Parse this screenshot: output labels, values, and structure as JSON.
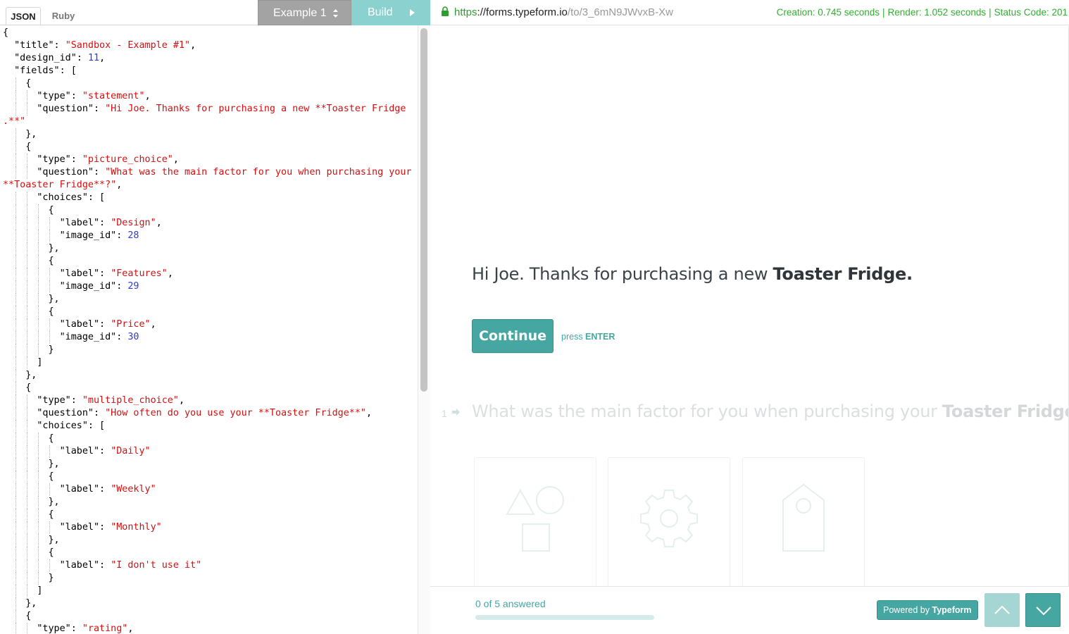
{
  "editor": {
    "tabs": [
      {
        "label": "JSON",
        "active": true
      },
      {
        "label": "Ruby",
        "active": false
      }
    ],
    "example_select": "Example 1",
    "build_label": "Build",
    "code_lines": [
      [
        [
          "p",
          "{"
        ]
      ],
      [
        [
          "p",
          "  \"title\": "
        ],
        [
          "s",
          "\"Sandbox - Example #1\""
        ],
        [
          "p",
          ","
        ]
      ],
      [
        [
          "p",
          "  \"design_id\": "
        ],
        [
          "n",
          "11"
        ],
        [
          "p",
          ","
        ]
      ],
      [
        [
          "p",
          "  \"fields\": ["
        ]
      ],
      [
        [
          "p",
          "    {"
        ]
      ],
      [
        [
          "p",
          "      \"type\": "
        ],
        [
          "s",
          "\"statement\""
        ],
        [
          "p",
          ","
        ]
      ],
      [
        [
          "p",
          "      \"question\": "
        ],
        [
          "s",
          "\"Hi Joe. Thanks for purchasing a new **Toaster Fridge"
        ]
      ],
      [
        [
          "s",
          ".**\""
        ]
      ],
      [
        [
          "p",
          "    },"
        ]
      ],
      [
        [
          "p",
          "    {"
        ]
      ],
      [
        [
          "p",
          "      \"type\": "
        ],
        [
          "s",
          "\"picture_choice\""
        ],
        [
          "p",
          ","
        ]
      ],
      [
        [
          "p",
          "      \"question\": "
        ],
        [
          "s",
          "\"What was the main factor for you when purchasing your"
        ]
      ],
      [
        [
          "s",
          "**Toaster Fridge**?\""
        ],
        [
          "p",
          ","
        ]
      ],
      [
        [
          "p",
          "      \"choices\": ["
        ]
      ],
      [
        [
          "p",
          "        {"
        ]
      ],
      [
        [
          "p",
          "          \"label\": "
        ],
        [
          "s",
          "\"Design\""
        ],
        [
          "p",
          ","
        ]
      ],
      [
        [
          "p",
          "          \"image_id\": "
        ],
        [
          "n",
          "28"
        ]
      ],
      [
        [
          "p",
          "        },"
        ]
      ],
      [
        [
          "p",
          "        {"
        ]
      ],
      [
        [
          "p",
          "          \"label\": "
        ],
        [
          "s",
          "\"Features\""
        ],
        [
          "p",
          ","
        ]
      ],
      [
        [
          "p",
          "          \"image_id\": "
        ],
        [
          "n",
          "29"
        ]
      ],
      [
        [
          "p",
          "        },"
        ]
      ],
      [
        [
          "p",
          "        {"
        ]
      ],
      [
        [
          "p",
          "          \"label\": "
        ],
        [
          "s",
          "\"Price\""
        ],
        [
          "p",
          ","
        ]
      ],
      [
        [
          "p",
          "          \"image_id\": "
        ],
        [
          "n",
          "30"
        ]
      ],
      [
        [
          "p",
          "        }"
        ]
      ],
      [
        [
          "p",
          "      ]"
        ]
      ],
      [
        [
          "p",
          "    },"
        ]
      ],
      [
        [
          "p",
          "    {"
        ]
      ],
      [
        [
          "p",
          "      \"type\": "
        ],
        [
          "s",
          "\"multiple_choice\""
        ],
        [
          "p",
          ","
        ]
      ],
      [
        [
          "p",
          "      \"question\": "
        ],
        [
          "s",
          "\"How often do you use your **Toaster Fridge**\""
        ],
        [
          "p",
          ","
        ]
      ],
      [
        [
          "p",
          "      \"choices\": ["
        ]
      ],
      [
        [
          "p",
          "        {"
        ]
      ],
      [
        [
          "p",
          "          \"label\": "
        ],
        [
          "s",
          "\"Daily\""
        ]
      ],
      [
        [
          "p",
          "        },"
        ]
      ],
      [
        [
          "p",
          "        {"
        ]
      ],
      [
        [
          "p",
          "          \"label\": "
        ],
        [
          "s",
          "\"Weekly\""
        ]
      ],
      [
        [
          "p",
          "        },"
        ]
      ],
      [
        [
          "p",
          "        {"
        ]
      ],
      [
        [
          "p",
          "          \"label\": "
        ],
        [
          "s",
          "\"Monthly\""
        ]
      ],
      [
        [
          "p",
          "        },"
        ]
      ],
      [
        [
          "p",
          "        {"
        ]
      ],
      [
        [
          "p",
          "          \"label\": "
        ],
        [
          "s",
          "\"I don't use it\""
        ]
      ],
      [
        [
          "p",
          "        }"
        ]
      ],
      [
        [
          "p",
          "      ]"
        ]
      ],
      [
        [
          "p",
          "    },"
        ]
      ],
      [
        [
          "p",
          "    {"
        ]
      ],
      [
        [
          "p",
          "      \"type\": "
        ],
        [
          "s",
          "\"rating\""
        ],
        [
          "p",
          ","
        ]
      ]
    ]
  },
  "preview": {
    "url_scheme": "https",
    "url_host": "://forms.typeform.io",
    "url_path": "/to/3_6mN9JWvxB-Xw",
    "stats": [
      "Creation: 0.745 seconds",
      "Render: 1.052 seconds",
      "Status Code: 201"
    ],
    "statement_text": "Hi Joe. Thanks for purchasing a new ",
    "statement_bold": "Toaster Fridge.",
    "continue_label": "Continue",
    "press_label": "press ",
    "enter_label": "ENTER",
    "q1_number": "1",
    "q1_text": "What was the main factor for you when purchasing your ",
    "q1_bold": "Toaster Fridge",
    "q1_end": "?",
    "picture_choices": [
      {
        "icon": "shapes-icon"
      },
      {
        "icon": "gear-icon"
      },
      {
        "icon": "price-tag-icon"
      }
    ],
    "progress_text": "0 of 5 answered",
    "progress_fraction": 0,
    "powered_prefix": "Powered by ",
    "powered_brand": "Typeform",
    "colors": {
      "accent": "#46a7a2",
      "accent_light": "#a6d6d3",
      "string": "#d40f0f",
      "number": "#2a3bd4",
      "status_ok": "#2fb02f"
    }
  }
}
